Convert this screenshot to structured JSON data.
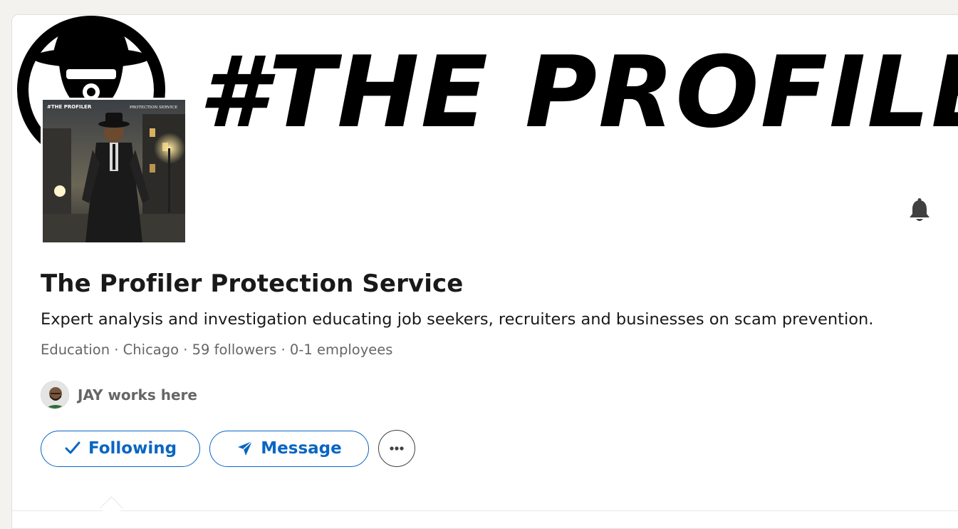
{
  "banner": {
    "text": "#THE PROFILER"
  },
  "logo_image": {
    "header_text": "#THE PROFILER",
    "subtitle_text": "PROTECTION SERVICE"
  },
  "company": {
    "name": "The Profiler Protection Service",
    "tagline": "Expert analysis and investigation educating job seekers, recruiters and businesses on scam prevention.",
    "meta": "Education · Chicago · 59 followers · 0-1 employees"
  },
  "employee": {
    "text": "JAY works here"
  },
  "actions": {
    "following_label": "Following",
    "message_label": "Message",
    "more_icon": "ellipsis-icon"
  },
  "icons": {
    "bell": "bell-icon",
    "check": "check-icon",
    "send": "send-icon"
  },
  "colors": {
    "accent": "#0a66c2",
    "text_primary": "#191919",
    "text_secondary": "#666666",
    "page_background": "#f4f2ee"
  }
}
